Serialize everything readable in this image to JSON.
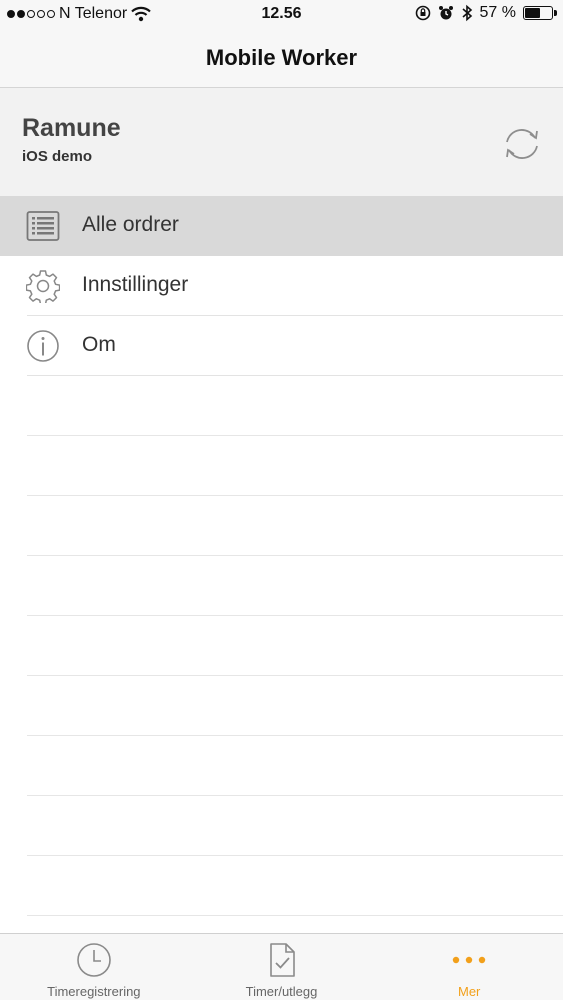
{
  "status_bar": {
    "carrier": "N Telenor",
    "time": "12.56",
    "battery_text": "57 %",
    "battery_level": 0.57,
    "signal_bars_filled": 2,
    "signal_bars_total": 5
  },
  "navbar": {
    "title": "Mobile Worker"
  },
  "profile": {
    "name": "Ramune",
    "subtitle": "iOS demo"
  },
  "menu": {
    "items": [
      {
        "label": "Alle ordrer",
        "icon": "list-icon",
        "selected": true
      },
      {
        "label": "Innstillinger",
        "icon": "gear-icon",
        "selected": false
      },
      {
        "label": "Om",
        "icon": "info-icon",
        "selected": false
      }
    ]
  },
  "tabbar": {
    "tabs": [
      {
        "label": "Timeregistrering",
        "icon": "clock-icon",
        "active": false
      },
      {
        "label": "Timer/utlegg",
        "icon": "document-check-icon",
        "active": false
      },
      {
        "label": "Mer",
        "icon": "more-dots-icon",
        "active": true
      }
    ]
  },
  "colors": {
    "accent": "#f2a01b",
    "selected_row": "#d9d9d9",
    "header_bg": "#f2f2f2"
  }
}
